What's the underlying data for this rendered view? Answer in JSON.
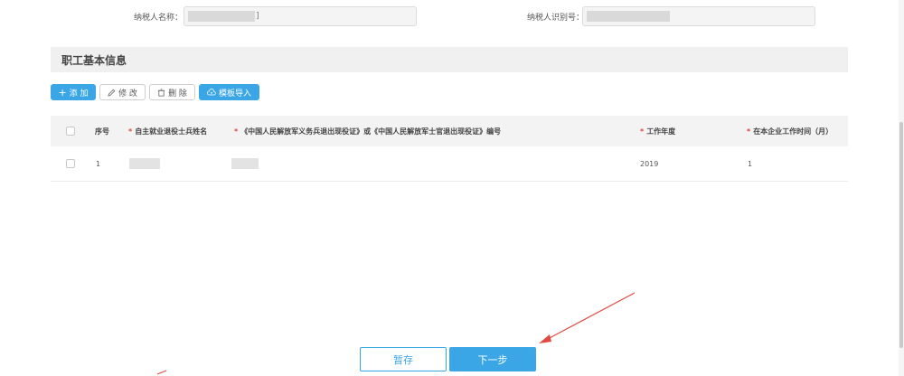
{
  "taxpayer": {
    "name_label": "纳税人名称：",
    "name_value": "",
    "id_label": "纳税人识别号：",
    "id_value": ""
  },
  "section": {
    "title": "职工基本信息"
  },
  "toolbar": {
    "add_label": "添 加",
    "edit_label": "修 改",
    "delete_label": "删 除",
    "import_label": "模板导入"
  },
  "table": {
    "headers": {
      "index": "序号",
      "name": "自主就业退役士兵姓名",
      "cert": "《中国人民解放军义务兵退出现役证》或《中国人民解放军士官退出现役证》编号",
      "year": "工作年度",
      "months": "在本企业工作时间（月）"
    },
    "rows": [
      {
        "index": "1",
        "name": "",
        "cert": "",
        "year": "2019",
        "months": "1"
      }
    ]
  },
  "footer": {
    "save_label": "暂存",
    "next_label": "下一步"
  },
  "colors": {
    "primary": "#3aa6e6",
    "annotation_arrow": "#e04a3f"
  }
}
